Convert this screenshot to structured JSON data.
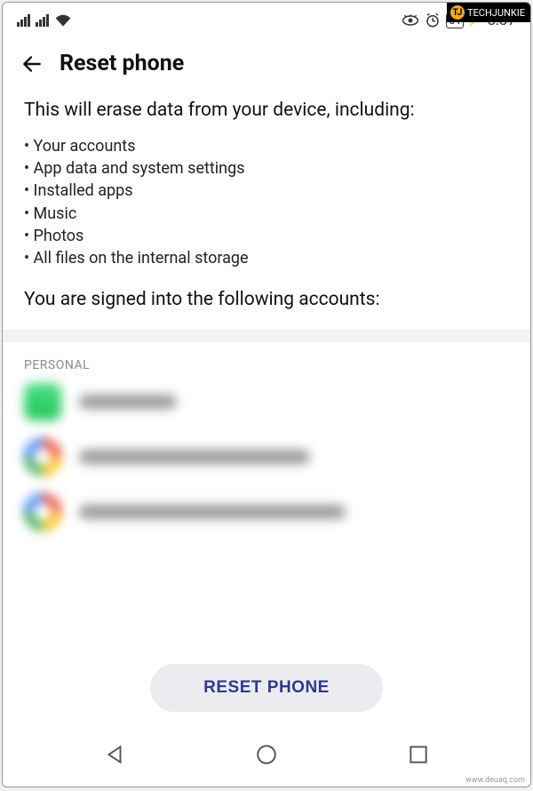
{
  "status": {
    "battery": "84",
    "time": "5:37"
  },
  "header": {
    "title": "Reset phone"
  },
  "body": {
    "intro": "This will erase data from your device, including:",
    "bullets": [
      "Your accounts",
      "App data and system settings",
      "Installed apps",
      "Music",
      "Photos",
      "All files on the internal storage"
    ],
    "signed_in_label": "You are signed into the following accounts:",
    "section_label": "PERSONAL",
    "accounts": [
      {
        "type": "whatsapp",
        "label_width": 110
      },
      {
        "type": "google",
        "label_width": 260
      },
      {
        "type": "google",
        "label_width": 300
      }
    ],
    "reset_button": "RESET PHONE"
  },
  "watermarks": {
    "top_right": "TECHJUNKIE",
    "bottom_right": "www.deuaq.com"
  }
}
